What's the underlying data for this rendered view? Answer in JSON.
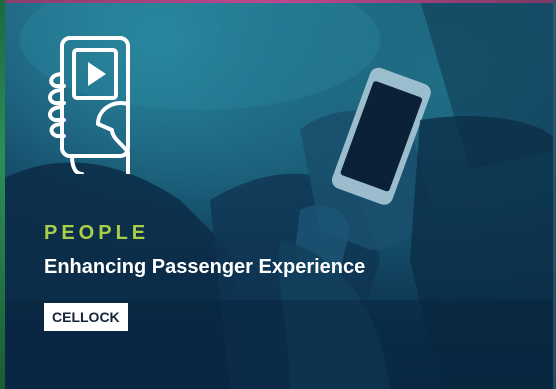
{
  "card": {
    "category": "PEOPLE",
    "headline": "Enhancing Passenger Experience",
    "tag": "CELLOCK"
  },
  "icons": {
    "pictogram": "hand-holding-phone-play-icon"
  },
  "colors": {
    "category": "#a9cf47",
    "headline": "#ffffff",
    "tag_background": "#ffffff",
    "tag_text": "#15233a",
    "overlay": "#103f5e"
  }
}
